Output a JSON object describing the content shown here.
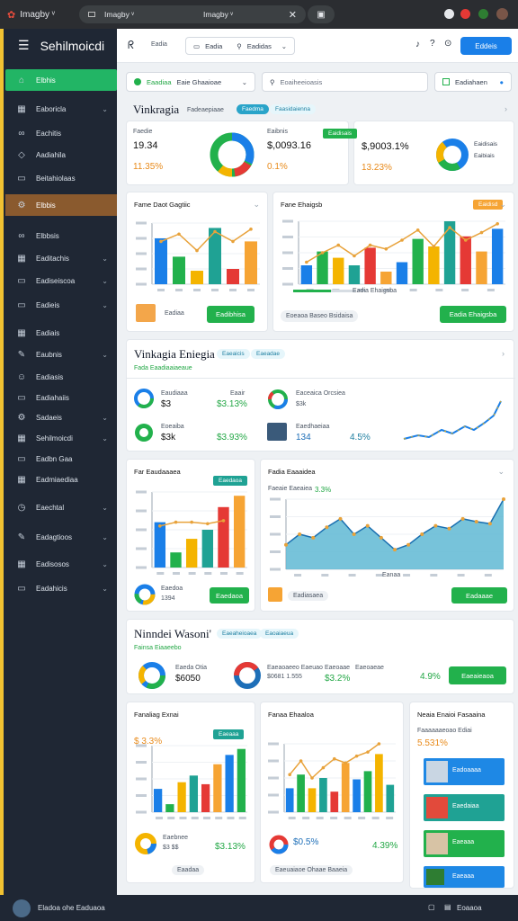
{
  "browser": {
    "tab_title": "Imagby ᵛ",
    "address": "Imagby ᵛ",
    "address_right": "Imagby ᵛ"
  },
  "sidebar": {
    "title": "Sehilmoicdi",
    "items": [
      {
        "label": "Elbhis",
        "icon": "dashboard-icon",
        "state": "active"
      },
      {
        "label": "Eaboricla",
        "icon": "grid-icon",
        "chevron": true
      },
      {
        "label": "Eachitis",
        "icon": "link-icon"
      },
      {
        "label": "Aadiahila",
        "icon": "tag-icon"
      },
      {
        "label": "Beitahiolaas",
        "icon": "card-icon"
      },
      {
        "label": "Elbbis",
        "icon": "gear-icon",
        "state": "highlight"
      },
      {
        "label": "Elbbsis",
        "icon": "link-icon"
      },
      {
        "label": "Eaditachis",
        "icon": "grid-icon",
        "chevron": true
      },
      {
        "label": "Eadiseiscoa",
        "icon": "card-icon",
        "chevron": true
      },
      {
        "label": "Eadieis",
        "icon": "folder-icon",
        "chevron": true
      },
      {
        "label": "Eadiais",
        "icon": "grid-icon"
      },
      {
        "label": "Eaubnis",
        "icon": "pen-icon",
        "chevron": true
      },
      {
        "label": "Eadiasis",
        "icon": "user-icon"
      },
      {
        "label": "Eadiahaiis",
        "icon": "card-icon"
      },
      {
        "label": "Sadaeis",
        "icon": "gear-icon",
        "chevron": true
      },
      {
        "label": "Sehilmoicdi",
        "icon": "grid-icon",
        "chevron": true
      },
      {
        "label": "Eadbn Gaa",
        "icon": "card-icon"
      },
      {
        "label": "Eadmiaediaa",
        "icon": "grid-icon"
      },
      {
        "label": "Eaechtal",
        "icon": "clock-icon",
        "chevron": true
      },
      {
        "label": "Eadagtioos",
        "icon": "pen-icon",
        "chevron": true
      },
      {
        "label": "Eadisosos",
        "icon": "grid-icon",
        "chevron": true
      },
      {
        "label": "Eadahicis",
        "icon": "folder-icon",
        "chevron": true
      }
    ]
  },
  "topbar": {
    "filter1": "Eadia",
    "filter2": "Eadidas",
    "button": "Eddeis"
  },
  "filters": {
    "left_chip": "Eaadiaa",
    "left_value": "Eaie Ghaaioae",
    "search": "Eoaiheeioasis",
    "right_value": "Eadiahaen"
  },
  "section1": {
    "title": "Vinkragia",
    "subtitle": "Fadeaepiaae",
    "badge1": "Faedma",
    "badge2": "Faasidaienna",
    "kpis": [
      {
        "label": "Faedie",
        "value": "19.34",
        "change": "11.35%",
        "tag": ""
      },
      {
        "label": "Eaibnis",
        "value": "$,0093.16",
        "change": "0.1%",
        "tag": "Eaidisais"
      },
      {
        "label": "Eaidisais",
        "value": "$,9003.1%",
        "change": "13.23%",
        "tag": "Eaibiais"
      }
    ],
    "chart_left": {
      "title": "Fame Daot Gagtiic",
      "btn": "Eadibhisa",
      "chip": "Eadiaa"
    },
    "chart_right": {
      "title": "Fane Ehaigsb",
      "tag": "Eaidisd",
      "btn": "Eadia Ehaigsba",
      "chip": "Eoeaoa Baseo Bsidaisa"
    }
  },
  "section2": {
    "title": "Vinkagia Eniegia",
    "badge1": "Eaeaicis",
    "badge2": "Eaeadae",
    "subtitle": "Fada Eaadiaaiaeaue",
    "stats": [
      {
        "label": "Eaudiaaa",
        "value": "$3",
        "side": "Eaair",
        "change": "$3.13%"
      },
      {
        "label": "Eaceaica Orcsiea",
        "value": "$3k",
        "side": "",
        "change": ""
      },
      {
        "label": "Eoeaiba",
        "value": "$3k",
        "side": "",
        "change": "$3.93%"
      },
      {
        "label": "Eaedhaeiaa",
        "value": "134",
        "side": "",
        "change": "4.5%"
      }
    ],
    "bar_card": {
      "title": "Far Eaudaaaea",
      "tag": "Eaedaoa",
      "label": "Eaedoa",
      "value": "1394",
      "btn": "Eaedaoa"
    },
    "area_card": {
      "title": "Fadia Eaaaidea",
      "subtitle": "Faeaie Eaeaiea",
      "change": "3.3%",
      "xlabel": "Eanaa",
      "btn": "Eadaaae",
      "chip": "Eadiasaea"
    }
  },
  "section3": {
    "title": "Ninndei Wasoni'",
    "badge1": "Eaeaheioaea",
    "badge2": "Eaoaiaeua",
    "subtitle": "Fainsa Eiaaeebo",
    "kpis": [
      {
        "label": "Eaeda Otia",
        "value": "$6050",
        "extra": ""
      },
      {
        "label": "Eaeaoaeeo Eaeuao",
        "value": "$0681 1.555",
        "extra": ""
      },
      {
        "label": "Eaeoaae",
        "value": "$3.2%",
        "extra": ""
      },
      {
        "label": "Eaeoaeae",
        "value": "",
        "extra": "4.9%"
      }
    ],
    "btn": "Eaeaieaoa"
  },
  "bottom": {
    "card1": {
      "title": "Fanaliag Exnai",
      "change": "$ 3.3%",
      "tag": "Eaeaaa",
      "value1": "Eaebnee",
      "value2": "$3 $$",
      "change2": "$3.13%",
      "chip": "Eaadaa"
    },
    "card2": {
      "title": "Fanaa Ehaaloa",
      "value1": "$0.5%",
      "change2": "4.39%",
      "chip": "Eaeuaiaoe Ohaae Baaeia"
    },
    "card3": {
      "title": "Neaia Enaioi Fasaaina",
      "subtitle": "Faaaaaaeoao Ediai",
      "change": "5.531%",
      "rows": [
        "Eadoaaaa",
        "Eaedaiaa",
        "Eaeaaa",
        "Eaeaaa"
      ]
    }
  },
  "footer": {
    "text": "Eladoa ohe Eaduaoa",
    "right": "Eoaaoa"
  },
  "chart_data": [
    {
      "type": "bar",
      "title": "Fame Daot Gagtiic",
      "series": [
        {
          "name": "",
          "values": [
            0.75,
            0.45,
            0.22,
            0.92,
            0.25,
            0.7
          ]
        }
      ],
      "overlay_line": [
        0.7,
        0.82,
        0.55,
        0.86,
        0.7,
        0.9
      ],
      "ylim": [
        0,
        1
      ]
    },
    {
      "type": "bar",
      "title": "Fane Ehaigsb",
      "series": [
        {
          "name": "",
          "values": [
            0.3,
            0.52,
            0.42,
            0.3,
            0.58,
            0.2,
            0.35,
            0.72,
            0.6,
            1.0,
            0.76,
            0.52,
            0.88
          ]
        }
      ],
      "overlay_line": [
        0.35,
        0.5,
        0.62,
        0.45,
        0.62,
        0.56,
        0.7,
        0.86,
        0.6,
        0.9,
        0.7,
        0.82,
        0.96
      ],
      "ylim": [
        0,
        1
      ]
    },
    {
      "type": "bar",
      "title": "Far Eaudaaaea",
      "series": [
        {
          "name": "",
          "values": [
            0.6,
            0.2,
            0.38,
            0.5,
            0.8,
            0.95
          ]
        }
      ],
      "overlay_line": [
        0.55,
        0.6,
        0.6,
        0.58,
        0.62
      ],
      "ylim": [
        0,
        1
      ]
    },
    {
      "type": "area",
      "title": "Fadia Eaaaidea",
      "series": [
        {
          "name": "",
          "values": [
            0.35,
            0.5,
            0.45,
            0.6,
            0.72,
            0.5,
            0.62,
            0.45,
            0.28,
            0.35,
            0.5,
            0.62,
            0.58,
            0.72,
            0.68,
            0.65,
            1.0
          ]
        }
      ],
      "ylim": [
        0,
        1
      ]
    },
    {
      "type": "bar",
      "title": "Fanaliag Exnai",
      "series": [
        {
          "name": "",
          "values": [
            0.35,
            0.12,
            0.45,
            0.55,
            0.42,
            0.72,
            0.86,
            0.95
          ]
        }
      ],
      "ylim": [
        0,
        1
      ]
    },
    {
      "type": "bar",
      "title": "Fanaa Ehaaloa",
      "series": [
        {
          "name": "",
          "values": [
            0.35,
            0.55,
            0.35,
            0.5,
            0.3,
            0.72,
            0.48,
            0.6,
            0.85,
            0.4
          ]
        }
      ],
      "overlay_line": [
        0.55,
        0.75,
        0.5,
        0.65,
        0.78,
        0.72,
        0.82,
        0.88,
        1.0
      ],
      "ylim": [
        0,
        1
      ]
    }
  ]
}
